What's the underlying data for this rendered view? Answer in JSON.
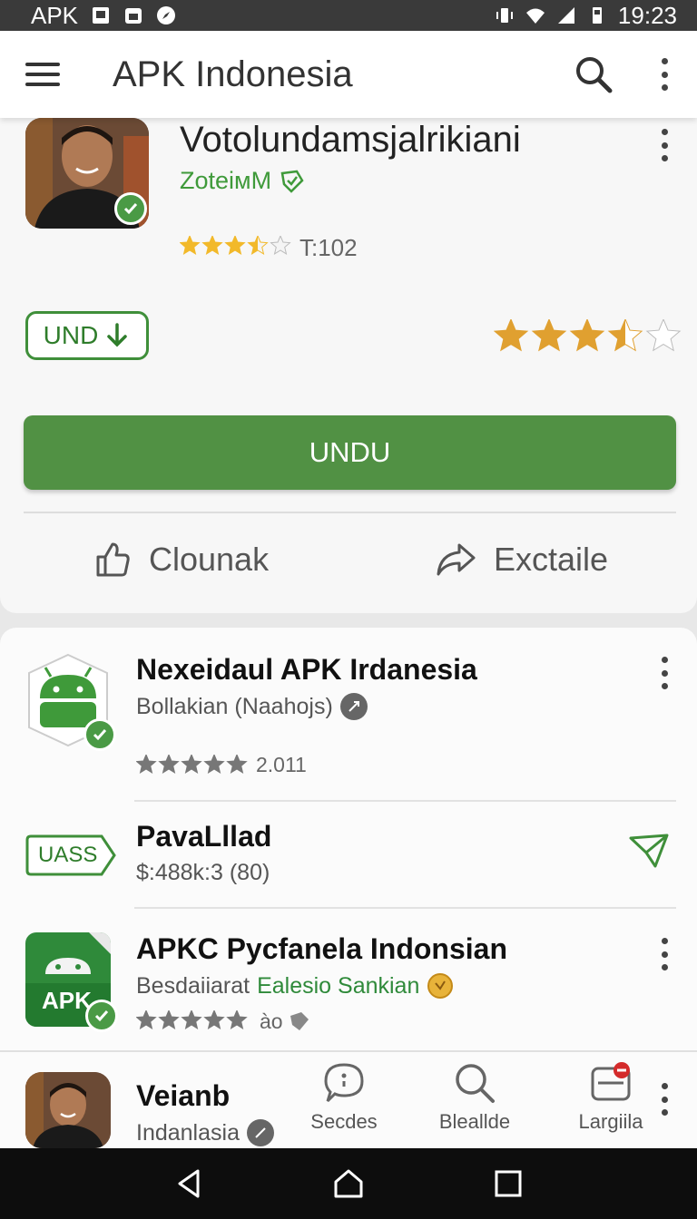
{
  "status_bar": {
    "carrier": "APK",
    "time": "19:23"
  },
  "app_bar": {
    "title": "APK Indonesia"
  },
  "featured": {
    "title": "Votolundamsjalrikiani",
    "developer": "ZoteiмM",
    "rating_text": "T:102",
    "rating_value": 3.5,
    "secondary_rating_value": 3.5,
    "outline_button_label": "UND",
    "install_button_label": "UNDU",
    "action_like_label": "Clounak",
    "action_share_label": "Exctaile"
  },
  "list": {
    "items": [
      {
        "title": "Nexeidaul APK Irdanesia",
        "subtitle": "Bollakian (Naahojs)",
        "rating_text": "2.011",
        "rating_value": 5
      },
      {
        "badge_label": "UASS",
        "title": "PavaLllad",
        "subtitle": "$:488k:3 (80)"
      },
      {
        "title": "APKC Pycfanela Indonsian",
        "subtitle_prefix": "Besdaiiarat",
        "subtitle_highlight": "Ealesio Sankian",
        "rating_text": "àο",
        "app_icon_label": "APK"
      },
      {
        "title": "Veianb",
        "subtitle": "Indanlasia"
      }
    ],
    "tabs": [
      {
        "label": "Secdes",
        "icon": "chat-icon"
      },
      {
        "label": "Bleallde",
        "icon": "search-icon"
      },
      {
        "label": "Largiila",
        "icon": "device-icon"
      }
    ]
  },
  "colors": {
    "accent_green": "#519144",
    "dev_green": "#3f9a3a",
    "star_gold": "#f2b92a",
    "status_bar": "#3a3a3a"
  }
}
